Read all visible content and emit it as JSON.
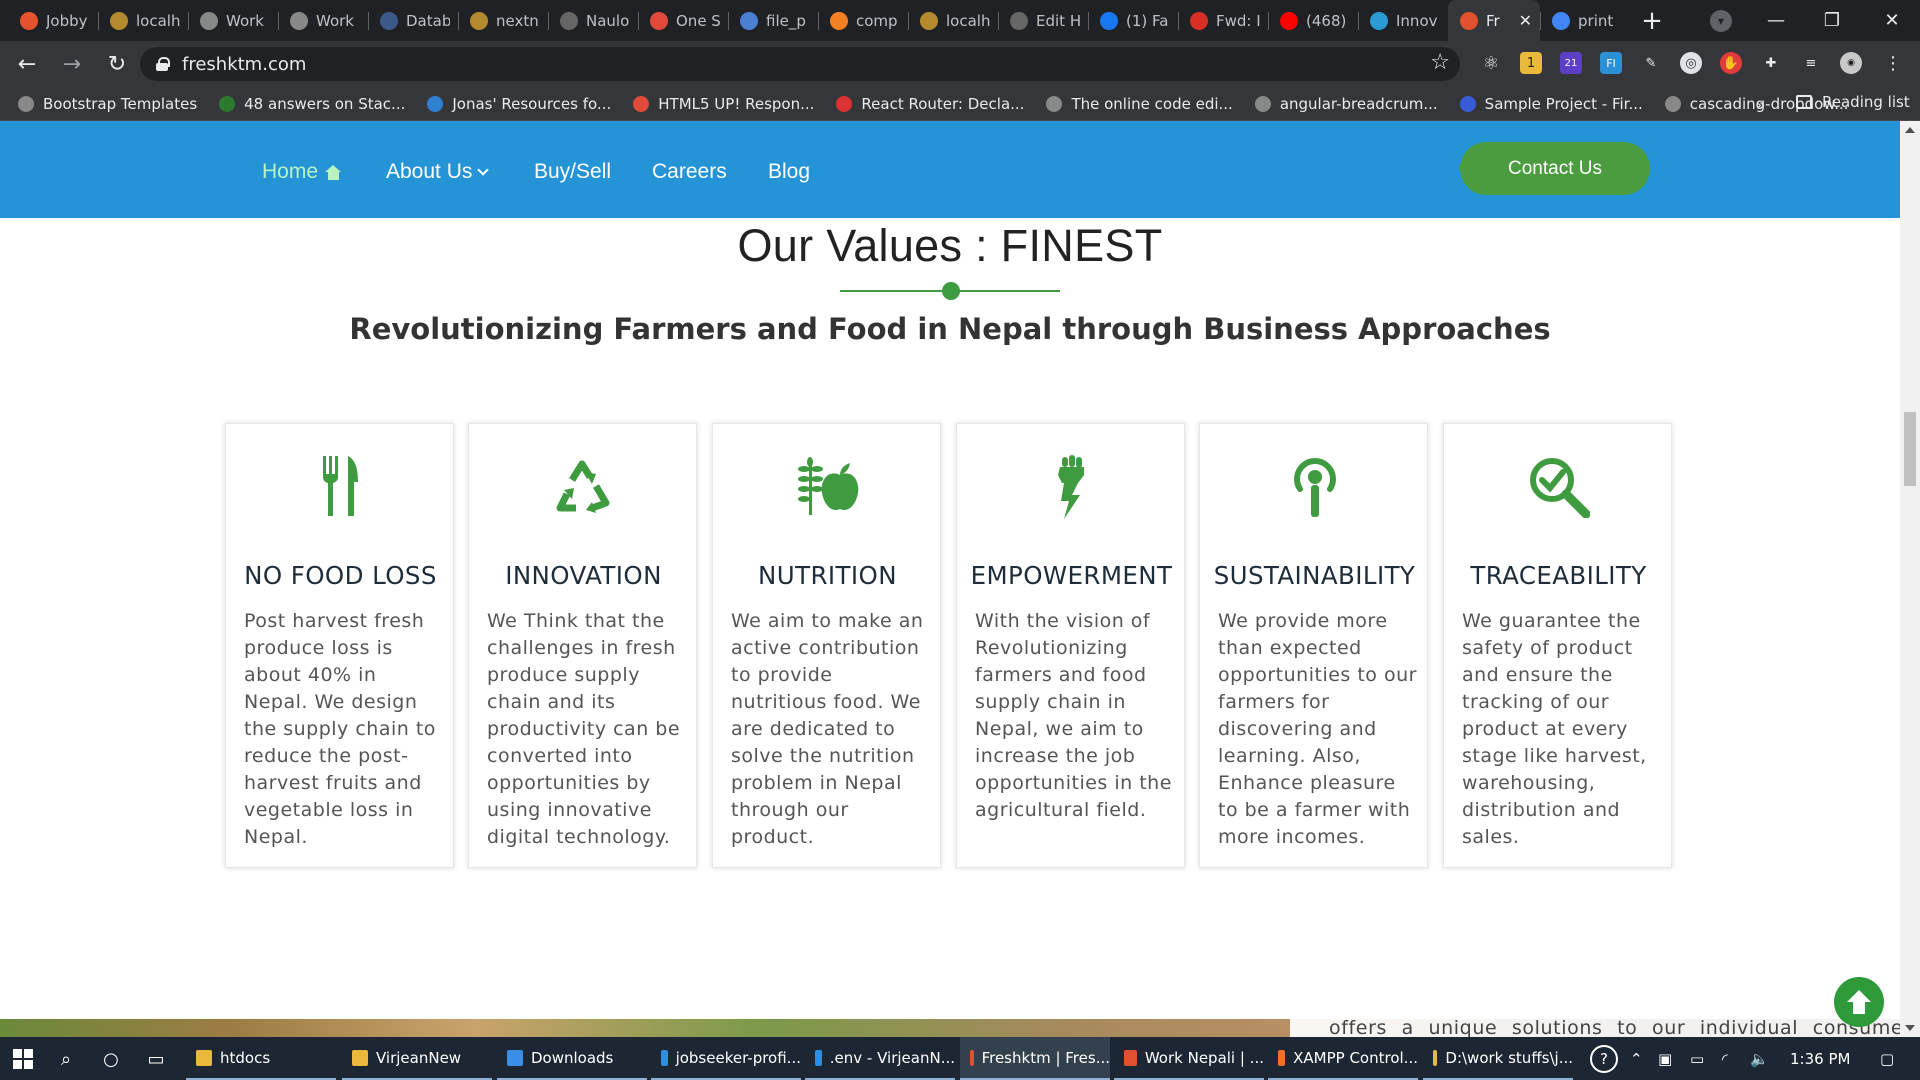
{
  "browser": {
    "tabs": [
      {
        "title": "Jobby",
        "color": "#e8512f"
      },
      {
        "title": "localh",
        "color": "#b58a2f"
      },
      {
        "title": "Work",
        "color": "#888"
      },
      {
        "title": "Work",
        "color": "#888"
      },
      {
        "title": "Datab",
        "color": "#3b5a8a"
      },
      {
        "title": "nextn",
        "color": "#b58a2f"
      },
      {
        "title": "Naulo",
        "color": "#666"
      },
      {
        "title": "One S",
        "color": "#e04a3a"
      },
      {
        "title": "file_p",
        "color": "#4a7fd1"
      },
      {
        "title": "comp",
        "color": "#f48024"
      },
      {
        "title": "localh",
        "color": "#b58a2f"
      },
      {
        "title": "Edit H",
        "color": "#666"
      },
      {
        "title": "(1) Fa",
        "color": "#1877f2"
      },
      {
        "title": "Fwd: I",
        "color": "#d93025"
      },
      {
        "title": "(468)",
        "color": "#ff0000"
      },
      {
        "title": "Innov",
        "color": "#2a9bd4"
      },
      {
        "title": "Fr",
        "color": "#e2512f",
        "active": true
      },
      {
        "title": "print",
        "color": "#4285f4"
      }
    ],
    "close_glyph": "✕",
    "new_tab_glyph": "+",
    "url": "freshktm.com",
    "bookmarks": [
      {
        "label": "Bootstrap Templates",
        "color": "#888"
      },
      {
        "label": "48 answers on Stac...",
        "color": "#2c7a2c"
      },
      {
        "label": "Jonas' Resources fo...",
        "color": "#2f80d1"
      },
      {
        "label": "HTML5 UP! Respon...",
        "color": "#e04a3a"
      },
      {
        "label": "React Router: Decla...",
        "color": "#d33"
      },
      {
        "label": "The online code edi...",
        "color": "#888"
      },
      {
        "label": "angular-breadcrum...",
        "color": "#888"
      },
      {
        "label": "Sample Project - Fir...",
        "color": "#3b5bd8"
      },
      {
        "label": "cascading-dropdow...",
        "color": "#888"
      }
    ],
    "bookmarks_more": "»",
    "reading_list": "Reading list",
    "ext_badges": {
      "badge1": "1",
      "badge2": "21",
      "badge3": "FI"
    }
  },
  "site": {
    "nav": {
      "home": "Home",
      "about": "About Us",
      "buysell": "Buy/Sell",
      "careers": "Careers",
      "blog": "Blog",
      "contact": "Contact Us"
    },
    "values_title": "Our Values : FINEST",
    "values_subtitle": "Revolutionizing Farmers and Food in Nepal through Business Approaches",
    "cards": [
      {
        "icon": "cutlery-icon",
        "title": "NO FOOD LOSS",
        "text": "Post harvest fresh produce loss is about 40% in Nepal. We design the supply chain to reduce the post-harvest fruits and vegetable loss in Nepal."
      },
      {
        "icon": "recycle-icon",
        "title": "INNOVATION",
        "text": "We Think that the challenges in fresh produce supply chain and its productivity can be converted into opportunities by using innovative digital technology."
      },
      {
        "icon": "nutrition-icon",
        "title": "NUTRITION",
        "text": "We aim to make an active contribution to provide nutritious food. We are dedicated to solve the nutrition problem in Nepal through our product."
      },
      {
        "icon": "fist-icon",
        "title": "EMPOWERMENT",
        "text": "With the vision of Revolutionizing farmers and food supply chain in Nepal, we aim to increase the job opportunities in the agricultural field."
      },
      {
        "icon": "broadcast-icon",
        "title": "SUSTAINABILITY",
        "text": "We provide more than expected opportunities to our farmers for discovering and learning. Also, Enhance pleasure to be a farmer with more incomes."
      },
      {
        "icon": "search-check-icon",
        "title": "TRACEABILITY",
        "text": "We guarantee the safety of product and ensure the tracking of our product at every stage like harvest, warehousing, distribution and sales."
      }
    ],
    "strip_text": "offers a unique solutions to our individual consumers,",
    "colors": {
      "nav_bg": "#2494d6",
      "accent_green": "#3f9b3f",
      "contact_bg": "#4b9c3e"
    }
  },
  "taskbar": {
    "apps": [
      {
        "label": "htdocs",
        "color": "#e8b93b"
      },
      {
        "label": "VirjeanNew",
        "color": "#e8b93b"
      },
      {
        "label": "Downloads",
        "color": "#3a8ee6"
      },
      {
        "label": "jobseeker-profi...",
        "color": "#2f8ee0"
      },
      {
        "label": ".env - VirjeanN...",
        "color": "#2f8ee0"
      },
      {
        "label": "Freshktm | Fres...",
        "color": "#e2512f",
        "active": true
      },
      {
        "label": "Work Nepali | ...",
        "color": "#e2512f"
      },
      {
        "label": "XAMPP Control...",
        "color": "#f0702b"
      },
      {
        "label": "D:\\work stuffs\\j...",
        "color": "#e8b93b"
      }
    ],
    "time": "1:36 PM"
  }
}
